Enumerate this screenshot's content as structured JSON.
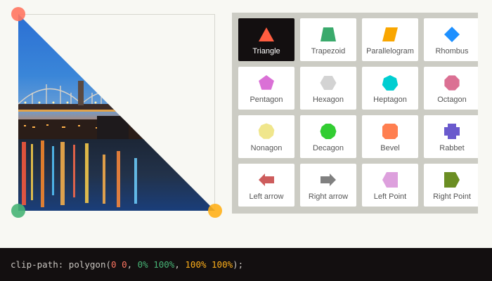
{
  "preview": {
    "handles": [
      {
        "name": "top-left-handle",
        "color": "#ff7561"
      },
      {
        "name": "bottom-left-handle",
        "color": "#47b476"
      },
      {
        "name": "bottom-right-handle",
        "color": "#ffb01a"
      }
    ]
  },
  "shapes": {
    "selected": "Triangle",
    "items": [
      {
        "label": "Triangle",
        "icon": "triangle-icon",
        "color": "#ff5d40"
      },
      {
        "label": "Trapezoid",
        "icon": "trapezoid-icon",
        "color": "#3aaa6c"
      },
      {
        "label": "Parallelogram",
        "icon": "parallelogram-icon",
        "color": "#f9a600"
      },
      {
        "label": "Rhombus",
        "icon": "rhombus-icon",
        "color": "#1e90ff"
      },
      {
        "label": "Pentagon",
        "icon": "pentagon-icon",
        "color": "#da70d6"
      },
      {
        "label": "Hexagon",
        "icon": "hexagon-icon",
        "color": "#d3d3d3"
      },
      {
        "label": "Heptagon",
        "icon": "heptagon-icon",
        "color": "#00ced1"
      },
      {
        "label": "Octagon",
        "icon": "octagon-icon",
        "color": "#db7093"
      },
      {
        "label": "Nonagon",
        "icon": "nonagon-icon",
        "color": "#f0e68c"
      },
      {
        "label": "Decagon",
        "icon": "decagon-icon",
        "color": "#32cd32"
      },
      {
        "label": "Bevel",
        "icon": "bevel-icon",
        "color": "#ff7f50"
      },
      {
        "label": "Rabbet",
        "icon": "rabbet-icon",
        "color": "#6a5acd"
      },
      {
        "label": "Left arrow",
        "icon": "left-arrow-icon",
        "color": "#cd5c5c"
      },
      {
        "label": "Right arrow",
        "icon": "right-arrow-icon",
        "color": "#808080"
      },
      {
        "label": "Left Point",
        "icon": "left-point-icon",
        "color": "#dda0dd"
      },
      {
        "label": "Right Point",
        "icon": "right-point-icon",
        "color": "#6b8e23"
      }
    ]
  },
  "code": {
    "property": "clip-path:",
    "fn_open": "polygon(",
    "points": [
      {
        "text": "0 0",
        "color": "#ff7561"
      },
      {
        "text": "0% 100%",
        "color": "#47b476"
      },
      {
        "text": "100% 100%",
        "color": "#ffb01a"
      }
    ],
    "fn_close": ");"
  }
}
